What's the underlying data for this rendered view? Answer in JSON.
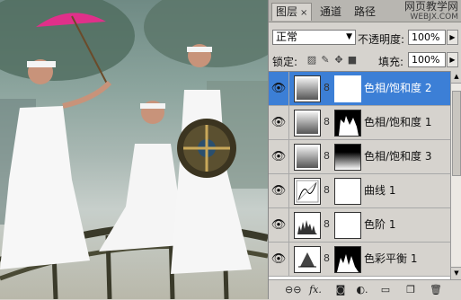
{
  "panel": {
    "tabs": [
      {
        "label": "图层",
        "close": "×",
        "active": true
      },
      {
        "label": "通道",
        "active": false
      },
      {
        "label": "路径",
        "active": false
      }
    ],
    "watermark": {
      "title": "网页教学网",
      "url": "WEBJX.COM"
    },
    "blend_mode": "正常",
    "opacity_label": "不透明度:",
    "opacity_value": "100%",
    "lock_label": "锁定:",
    "fill_label": "填充:",
    "fill_value": "100%",
    "layers": [
      {
        "name": "色相/饱和度 2",
        "selected": true,
        "icon": "hue-saturation-thumb"
      },
      {
        "name": "色相/饱和度 1",
        "selected": false,
        "icon": "hue-saturation-thumb"
      },
      {
        "name": "色相/饱和度 3",
        "selected": false,
        "icon": "hue-saturation-thumb"
      },
      {
        "name": "曲线 1",
        "selected": false,
        "icon": "curves-thumb"
      },
      {
        "name": "色阶 1",
        "selected": false,
        "icon": "levels-thumb"
      },
      {
        "name": "色彩平衡 1",
        "selected": false,
        "icon": "color-balance-thumb"
      }
    ],
    "bottom_icons": [
      "link-layers-icon",
      "fx-icon",
      "add-mask-icon",
      "adjustment-layer-icon",
      "group-icon",
      "new-layer-icon",
      "trash-icon"
    ],
    "colors": {
      "selection": "#3c7fd6",
      "panel_bg": "#d6d3ce"
    }
  }
}
